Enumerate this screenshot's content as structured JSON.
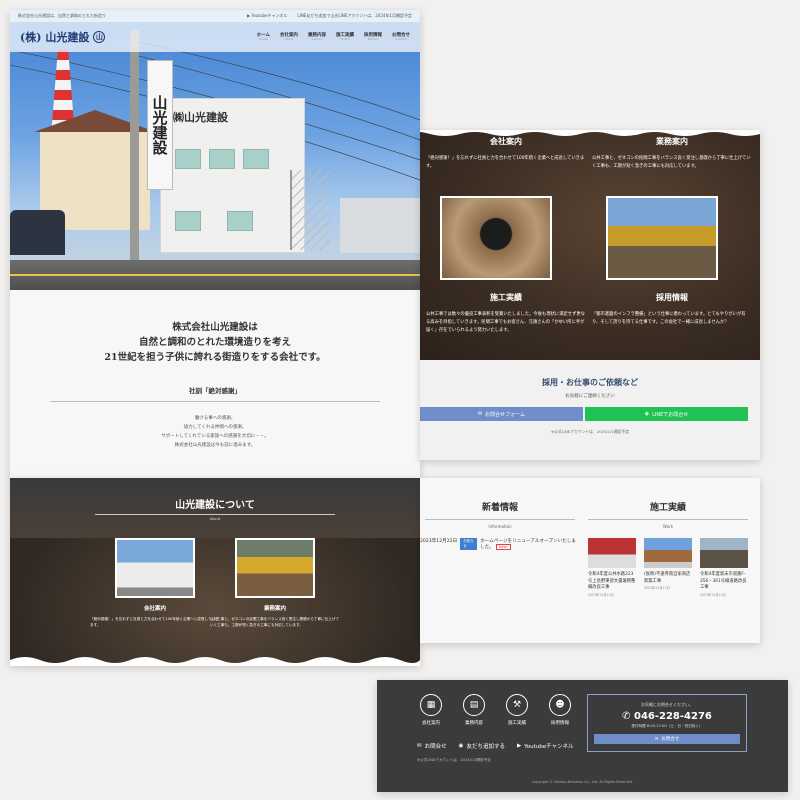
{
  "header": {
    "tagline": "株式会社山光建設は、自然と調和のとれた街造り",
    "youtube": "Youtubeチャンネル",
    "line_notice": "LINE友だち追加で山光LINEアカウントは、2024年1月開設予定",
    "logo_text": "山光建設",
    "logo_prefix": "(株)",
    "nav": [
      {
        "label": "ホーム",
        "sub": "Home"
      },
      {
        "label": "会社案内",
        "sub": "About"
      },
      {
        "label": "業務内容",
        "sub": "Service"
      },
      {
        "label": "施工実績",
        "sub": "Works"
      },
      {
        "label": "採用情報",
        "sub": "Recruit"
      },
      {
        "label": "お問合せ",
        "sub": "Contact"
      }
    ]
  },
  "hero": {
    "vertical_sign": "山光建設",
    "building_sign": "㈱山光建設"
  },
  "intro": {
    "lines": [
      "株式会社山光建設は",
      "自然と調和のとれた環境造りを考え",
      "21世紀を担う子供に誇れる街造りをする会社です。"
    ],
    "motto_title": "社訓「絶対感謝」",
    "motto_lines": [
      "働ける事への感謝。",
      "協力してくれる仲間への感謝。",
      "サポートしてくれている家族への感謝を大切に・・。",
      "株式会社山光建設は今も前に進みます。"
    ]
  },
  "services": {
    "company": {
      "title": "会社案内",
      "text": "「絶対感謝！」を忘れずに社員と力を合わせて100年続く企業へと成長していきます。"
    },
    "business": {
      "title": "業務案内",
      "text": "公共工事と、ゼネコンの民間工事をバランス良く受注し基礎から丁寧に仕上げていく工事も、工期が短く急ぎの工事にも対応しています。"
    },
    "works": {
      "title": "施工実績",
      "text": "公共工事では数々の優良工事表彰を受賞いたしました。今後も現状に満足せず更なる高みを目指していきます。民間工事でもお客さん、元請さんの「かゆい所に手が届く」存在でいられるよう努力いたします。"
    },
    "recruit": {
      "title": "採用情報",
      "text": "「都市基盤のインフラ整備」という仕事に携わっています。とてもやりがいが有り、そして誇りを持てる仕事です。この会社で一緒に成長しませんか？"
    }
  },
  "cta": {
    "title": "採用・お仕事のご依頼など",
    "sub": "お気軽にご連絡ください",
    "form_button": "お問合せフォーム",
    "line_button": "LINEでお問合せ",
    "note": "※公式LINEアカウントは、2024/1/1開設予定"
  },
  "about": {
    "title": "山光建設について",
    "sub": "About",
    "cards": [
      {
        "title": "会社案内",
        "text": "「絶対感謝！」を忘れずに社員と力を合わせて100年続く企業へと成長していきます。"
      },
      {
        "title": "業務案内",
        "text": "公共工事と、ゼネコンの民間工事をバランス良く受注し基礎から丁寧に仕上げていく工事も、工期が短く急ぎの工事にも対応しています。"
      }
    ]
  },
  "news": {
    "title": "新着情報",
    "sub": "Information",
    "items": [
      {
        "date": "2023年12月22日",
        "category": "お知らせ",
        "text": "ホームページをリニューアルオープンいたしました。",
        "badge": "New!"
      }
    ]
  },
  "works": {
    "title": "施工実績",
    "sub": "Work",
    "items": [
      {
        "title": "令和4年度公共水路223号上長野東部文書兼務整備改良工事",
        "date": "2023年12月12日"
      },
      {
        "title": "(仮称)不遠寺南自家商店新築工事",
        "date": "2023年12月12日"
      },
      {
        "title": "令和4年度第未市道路F-356・361号線道路改良工事",
        "date": "2023年12月12日"
      }
    ]
  },
  "footer": {
    "icons": [
      {
        "label": "会社案内",
        "icon": "building-icon",
        "glyph": "▦"
      },
      {
        "label": "業務内容",
        "icon": "clipboard-icon",
        "glyph": "▤"
      },
      {
        "label": "施工実績",
        "icon": "hammer-icon",
        "glyph": "⚒"
      },
      {
        "label": "採用情報",
        "icon": "people-icon",
        "glyph": "☻"
      }
    ],
    "links": [
      {
        "label": "お問合せ",
        "icon": "mail-icon"
      },
      {
        "label": "友だち追加する",
        "icon": "line-icon"
      },
      {
        "label": "Youtubeチャンネル",
        "icon": "youtube-icon"
      }
    ],
    "note": "※公式LINEアカウントは、2024/1/1開設予定",
    "contact_label": "お気軽にお問合せください。",
    "phone": "046-228-4276",
    "hours": "受付時間 8:00-17:00（土・日・祝日除く）",
    "contact_button": "お問合せ",
    "copyright": "Copyright © Sankou-Kensetsu Co., Ltd. All Rights Reserved."
  },
  "colors": {
    "brand_blue": "#1f3b70",
    "form_button": "#6f8dc9",
    "line_green": "#1fc253",
    "footer_bg": "#3b3b3b"
  }
}
